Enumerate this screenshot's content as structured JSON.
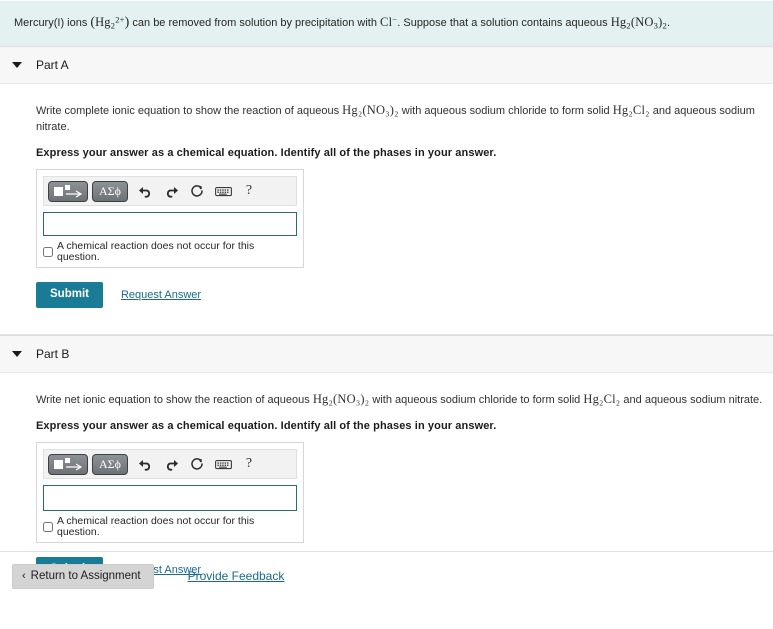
{
  "banner": {
    "prefix": "Mercury(I) ions ",
    "ion_formula": "Hg",
    "ion_sub": "2",
    "ion_sup": "2+",
    "middle": " can be removed from solution by precipitation with ",
    "chloride": "Cl",
    "chloride_sup": "−",
    "suffix": ". Suppose that a solution contains aqueous ",
    "nitrate_hg": "Hg",
    "nitrate_hg_sub": "2",
    "nitrate_group": "(NO",
    "nitrate_group_sub": "3",
    "nitrate_group_close": ")",
    "nitrate_group_sub2": "2",
    "end": "."
  },
  "parts": [
    {
      "title": "Part A",
      "caret_icon": "caret-down-icon",
      "question": {
        "lead": "Write complete ionic equation to show the reaction of aqueous ",
        "reactant": "Hg₂(NO₃)₂",
        "mid": " with aqueous sodium chloride to form solid ",
        "product": "Hg₂Cl₂",
        "tail": " and aqueous sodium nitrate."
      },
      "instruction": "Express your answer as a chemical equation. Identify all of the phases in your answer.",
      "toolbar": {
        "template_button_label": "template-icon",
        "greek_button_label": "ΑΣϕ",
        "undo_label": "undo-arrow-icon",
        "redo_label": "redo-arrow-icon",
        "reset_label": "reset-icon",
        "keyboard_label": "keyboard-icon",
        "help_label": "?"
      },
      "answer_value": "",
      "answer_placeholder": "",
      "no_reaction_label": "A chemical reaction does not occur for this question.",
      "no_reaction_checked": false,
      "submit_label": "Submit",
      "request_answer_label": "Request Answer"
    },
    {
      "title": "Part B",
      "caret_icon": "caret-down-icon",
      "question": {
        "lead": "Write net ionic equation to show the reaction of aqueous ",
        "reactant": "Hg₂(NO₃)₂",
        "mid": " with aqueous sodium chloride to form solid ",
        "product": "Hg₂Cl₂",
        "tail": " and aqueous sodium nitrate."
      },
      "instruction": "Express your answer as a chemical equation. Identify all of the phases in your answer.",
      "toolbar": {
        "template_button_label": "template-icon",
        "greek_button_label": "ΑΣϕ",
        "undo_label": "undo-arrow-icon",
        "redo_label": "redo-arrow-icon",
        "reset_label": "reset-icon",
        "keyboard_label": "keyboard-icon",
        "help_label": "?"
      },
      "answer_value": "",
      "answer_placeholder": "",
      "no_reaction_label": "A chemical reaction does not occur for this question.",
      "no_reaction_checked": false,
      "submit_label": "Submit",
      "request_answer_label": "Request Answer"
    }
  ],
  "footer": {
    "return_label": "Return to Assignment",
    "return_chevron": "‹",
    "feedback_label": "Provide Feedback"
  },
  "colors": {
    "banner_bg": "#e4f1f1",
    "part_header_bg": "#f7f7f7",
    "submit_bg": "#1a7b96",
    "link": "#1a6a8a",
    "input_border": "#2e6b6b",
    "return_bg": "#d4d4d4"
  }
}
